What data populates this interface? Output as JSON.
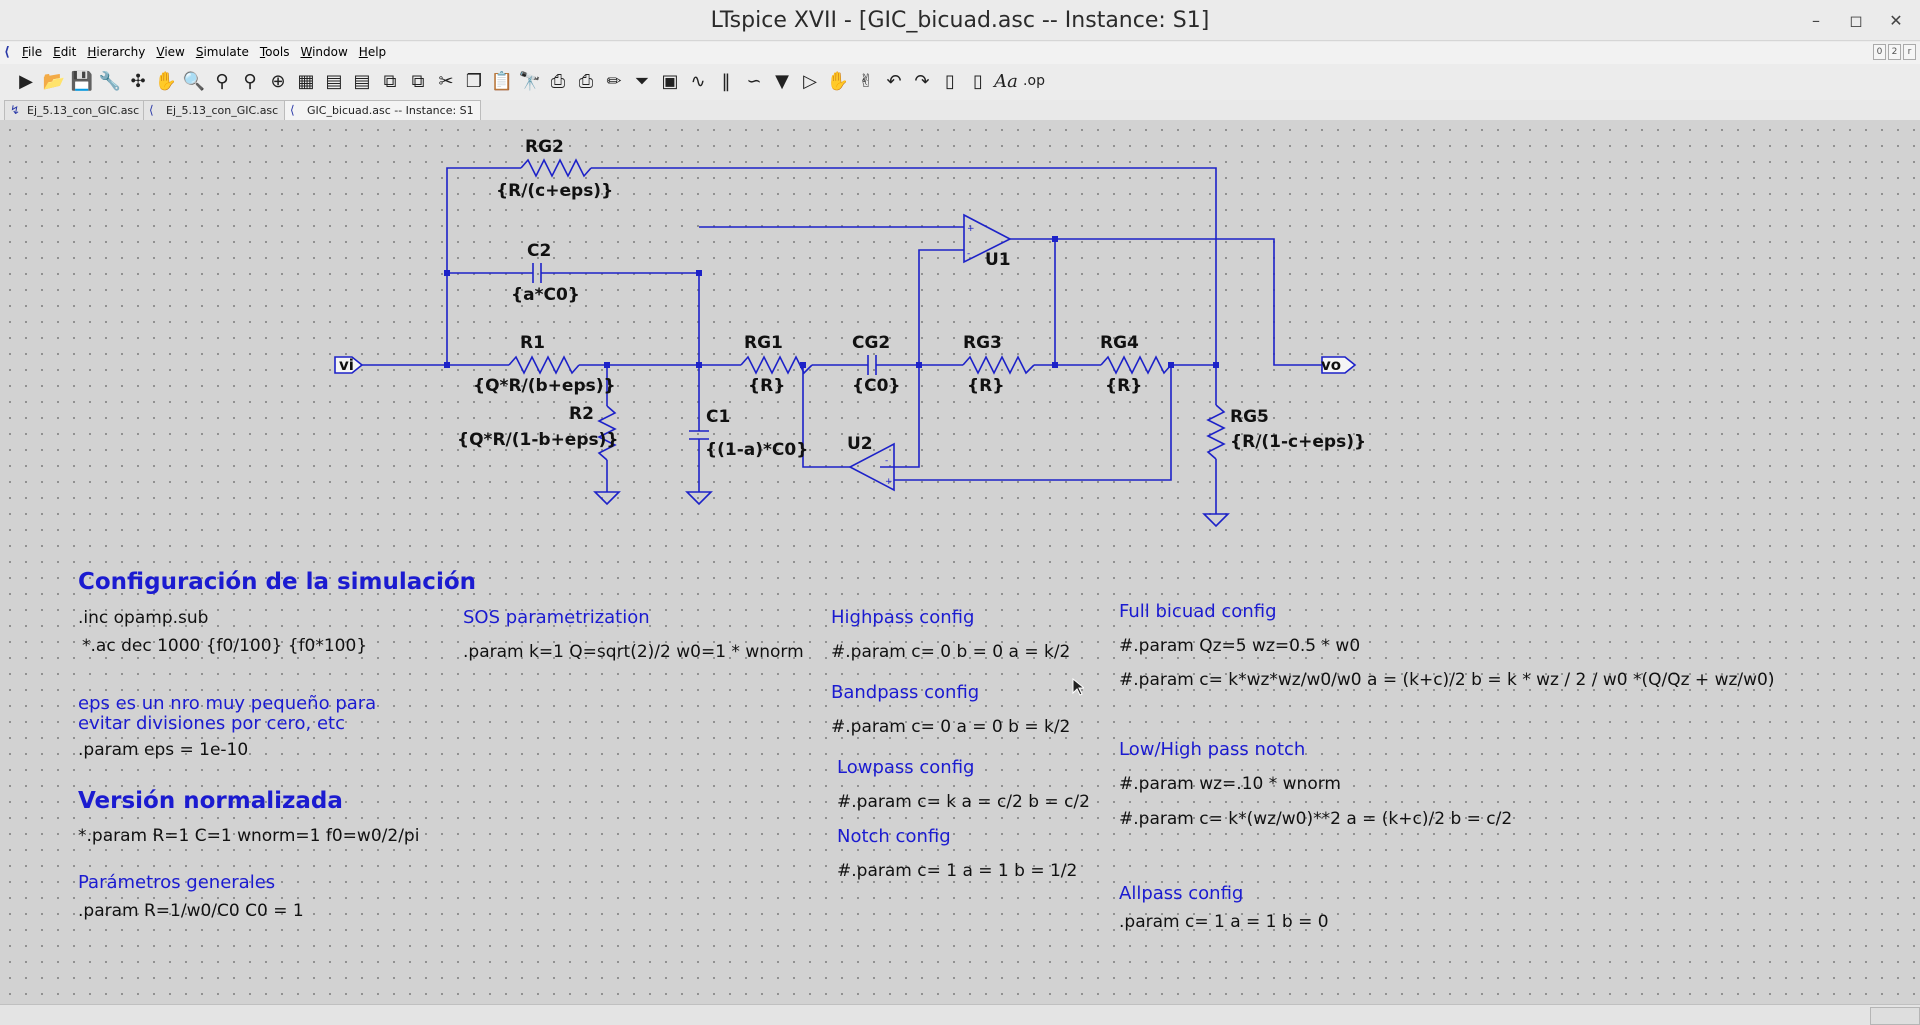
{
  "window": {
    "title": "LTspice XVII - [GIC_bicuad.asc -- Instance: S1]"
  },
  "menu": [
    "File",
    "Edit",
    "Hierarchy",
    "View",
    "Simulate",
    "Tools",
    "Window",
    "Help"
  ],
  "tabs": [
    {
      "label": "Ej_5.13_con_GIC.asc",
      "active": false
    },
    {
      "label": "Ej_5.13_con_GIC.asc",
      "active": false
    },
    {
      "label": "GIC_bicuad.asc -- Instance: S1",
      "active": true
    }
  ],
  "schematic": {
    "rg2": {
      "name": "RG2",
      "value": "{R/(c+eps)}"
    },
    "c2": {
      "name": "C2",
      "value": "{a*C0}"
    },
    "r1": {
      "name": "R1",
      "value": "{Q*R/(b+eps)}"
    },
    "r2": {
      "name": "R2",
      "value": "{Q*R/(1-b+eps)}"
    },
    "c1": {
      "name": "C1",
      "value": "{(1-a)*C0}"
    },
    "rg1": {
      "name": "RG1",
      "value": "{R}"
    },
    "cg2": {
      "name": "CG2",
      "value": "{C0}"
    },
    "rg3": {
      "name": "RG3",
      "value": "{R}"
    },
    "rg4": {
      "name": "RG4",
      "value": "{R}"
    },
    "rg5": {
      "name": "RG5",
      "value": "{R/(1-c+eps)}"
    },
    "u1": "U1",
    "u2": "U2",
    "vi": "vi",
    "vo": "vo"
  },
  "notes": {
    "config_title": "Configuración de la simulación",
    "inc": ".inc opamp.sub",
    "ac": "*.ac dec 1000 {f0/100} {f0*100}",
    "eps_comment_1": "eps es un nro muy pequeño para",
    "eps_comment_2": "evitar divisiones por cero, etc",
    "eps_param": ".param eps = 1e-10",
    "norm_title": "Versión normalizada",
    "norm_param": "*.param R=1 C=1 wnorm=1 f0=w0/2/pi",
    "gen_title": "Parámetros generales",
    "gen_param": ".param R=1/w0/C0 C0 = 1",
    "sos_title": "SOS parametrization",
    "sos_param": ".param k=1 Q=sqrt(2)/2 w0=1 * wnorm",
    "hp_title": "Highpass config",
    "hp_param": "#.param c= 0 b = 0 a = k/2",
    "bp_title": "Bandpass config",
    "bp_param": "#.param c= 0 a = 0 b = k/2",
    "lp_title": "Lowpass config",
    "lp_param": "#.param c= k a = c/2 b = c/2",
    "notch_title": "Notch config",
    "notch_param": "#.param c= 1 a = 1 b = 1/2",
    "full_title": "Full bicuad config",
    "full_param1": "#.param Qz=5 wz=0.5 * w0",
    "full_param2": "#.param c= k*wz*wz/w0/w0 a = (k+c)/2 b = k * wz / 2 / w0 *(Q/Qz + wz/w0)",
    "lhn_title": "Low/High pass notch",
    "lhn_param1": "#.param  wz=.10 * wnorm",
    "lhn_param2": "#.param c= k*(wz/w0)**2 a = (k+c)/2 b = c/2",
    "ap_title": "Allpass config",
    "ap_param": ".param c= 1 a = 1 b = 0"
  },
  "colors": {
    "wire": "#1d22c8",
    "component": "#1d22c8",
    "note_blue": "#1b1bd0",
    "canvas": "#d2d2d2"
  }
}
